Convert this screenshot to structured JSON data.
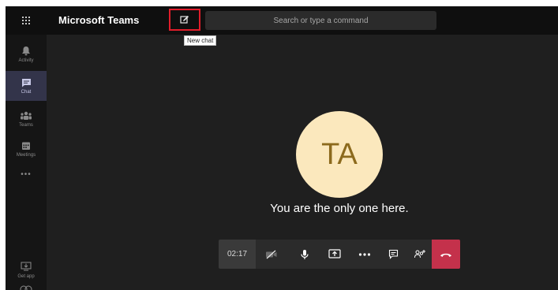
{
  "app": {
    "title": "Microsoft Teams"
  },
  "search": {
    "placeholder": "Search or type a command"
  },
  "tooltip": {
    "new_chat": "New chat"
  },
  "rail": {
    "items": [
      {
        "label": "Activity",
        "icon": "bell-icon"
      },
      {
        "label": "Chat",
        "icon": "chat-icon",
        "active": true
      },
      {
        "label": "Teams",
        "icon": "teams-icon"
      },
      {
        "label": "Meetings",
        "icon": "calendar-icon"
      }
    ],
    "more": "•••",
    "get_app": {
      "label": "Get app",
      "icon": "download-icon"
    }
  },
  "stage": {
    "avatar_initials": "TA",
    "message": "You are the only one here."
  },
  "callbar": {
    "timer": "02:17",
    "buttons": [
      "camera-off-icon",
      "mic-icon",
      "share-screen-icon",
      "more-icon",
      "conversation-icon",
      "participants-icon",
      "hang-up-icon"
    ]
  },
  "colors": {
    "accent_red": "#c4314b",
    "highlight_box": "#e11d2a",
    "avatar_bg": "#fbe8bd",
    "rail_active": "#33344a"
  }
}
